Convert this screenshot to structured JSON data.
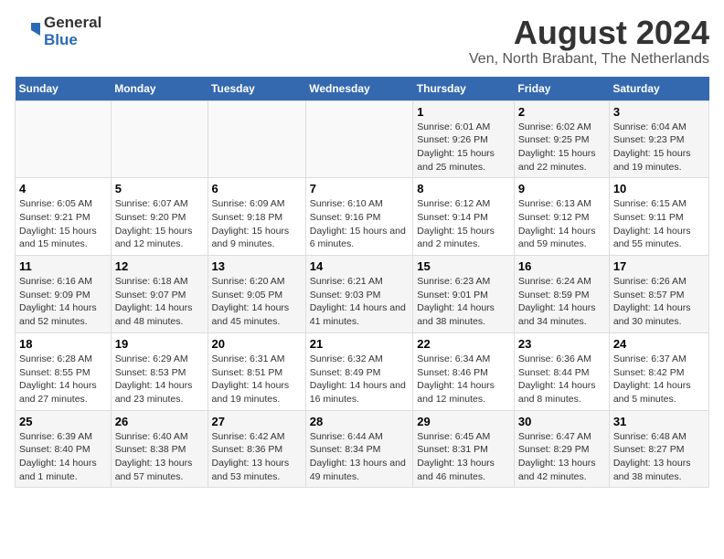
{
  "logo": {
    "general": "General",
    "blue": "Blue"
  },
  "title": "August 2024",
  "subtitle": "Ven, North Brabant, The Netherlands",
  "days_of_week": [
    "Sunday",
    "Monday",
    "Tuesday",
    "Wednesday",
    "Thursday",
    "Friday",
    "Saturday"
  ],
  "weeks": [
    [
      {
        "day": "",
        "info": ""
      },
      {
        "day": "",
        "info": ""
      },
      {
        "day": "",
        "info": ""
      },
      {
        "day": "",
        "info": ""
      },
      {
        "day": "1",
        "info": "Sunrise: 6:01 AM\nSunset: 9:26 PM\nDaylight: 15 hours and 25 minutes."
      },
      {
        "day": "2",
        "info": "Sunrise: 6:02 AM\nSunset: 9:25 PM\nDaylight: 15 hours and 22 minutes."
      },
      {
        "day": "3",
        "info": "Sunrise: 6:04 AM\nSunset: 9:23 PM\nDaylight: 15 hours and 19 minutes."
      }
    ],
    [
      {
        "day": "4",
        "info": "Sunrise: 6:05 AM\nSunset: 9:21 PM\nDaylight: 15 hours and 15 minutes."
      },
      {
        "day": "5",
        "info": "Sunrise: 6:07 AM\nSunset: 9:20 PM\nDaylight: 15 hours and 12 minutes."
      },
      {
        "day": "6",
        "info": "Sunrise: 6:09 AM\nSunset: 9:18 PM\nDaylight: 15 hours and 9 minutes."
      },
      {
        "day": "7",
        "info": "Sunrise: 6:10 AM\nSunset: 9:16 PM\nDaylight: 15 hours and 6 minutes."
      },
      {
        "day": "8",
        "info": "Sunrise: 6:12 AM\nSunset: 9:14 PM\nDaylight: 15 hours and 2 minutes."
      },
      {
        "day": "9",
        "info": "Sunrise: 6:13 AM\nSunset: 9:12 PM\nDaylight: 14 hours and 59 minutes."
      },
      {
        "day": "10",
        "info": "Sunrise: 6:15 AM\nSunset: 9:11 PM\nDaylight: 14 hours and 55 minutes."
      }
    ],
    [
      {
        "day": "11",
        "info": "Sunrise: 6:16 AM\nSunset: 9:09 PM\nDaylight: 14 hours and 52 minutes."
      },
      {
        "day": "12",
        "info": "Sunrise: 6:18 AM\nSunset: 9:07 PM\nDaylight: 14 hours and 48 minutes."
      },
      {
        "day": "13",
        "info": "Sunrise: 6:20 AM\nSunset: 9:05 PM\nDaylight: 14 hours and 45 minutes."
      },
      {
        "day": "14",
        "info": "Sunrise: 6:21 AM\nSunset: 9:03 PM\nDaylight: 14 hours and 41 minutes."
      },
      {
        "day": "15",
        "info": "Sunrise: 6:23 AM\nSunset: 9:01 PM\nDaylight: 14 hours and 38 minutes."
      },
      {
        "day": "16",
        "info": "Sunrise: 6:24 AM\nSunset: 8:59 PM\nDaylight: 14 hours and 34 minutes."
      },
      {
        "day": "17",
        "info": "Sunrise: 6:26 AM\nSunset: 8:57 PM\nDaylight: 14 hours and 30 minutes."
      }
    ],
    [
      {
        "day": "18",
        "info": "Sunrise: 6:28 AM\nSunset: 8:55 PM\nDaylight: 14 hours and 27 minutes."
      },
      {
        "day": "19",
        "info": "Sunrise: 6:29 AM\nSunset: 8:53 PM\nDaylight: 14 hours and 23 minutes."
      },
      {
        "day": "20",
        "info": "Sunrise: 6:31 AM\nSunset: 8:51 PM\nDaylight: 14 hours and 19 minutes."
      },
      {
        "day": "21",
        "info": "Sunrise: 6:32 AM\nSunset: 8:49 PM\nDaylight: 14 hours and 16 minutes."
      },
      {
        "day": "22",
        "info": "Sunrise: 6:34 AM\nSunset: 8:46 PM\nDaylight: 14 hours and 12 minutes."
      },
      {
        "day": "23",
        "info": "Sunrise: 6:36 AM\nSunset: 8:44 PM\nDaylight: 14 hours and 8 minutes."
      },
      {
        "day": "24",
        "info": "Sunrise: 6:37 AM\nSunset: 8:42 PM\nDaylight: 14 hours and 5 minutes."
      }
    ],
    [
      {
        "day": "25",
        "info": "Sunrise: 6:39 AM\nSunset: 8:40 PM\nDaylight: 14 hours and 1 minute."
      },
      {
        "day": "26",
        "info": "Sunrise: 6:40 AM\nSunset: 8:38 PM\nDaylight: 13 hours and 57 minutes."
      },
      {
        "day": "27",
        "info": "Sunrise: 6:42 AM\nSunset: 8:36 PM\nDaylight: 13 hours and 53 minutes."
      },
      {
        "day": "28",
        "info": "Sunrise: 6:44 AM\nSunset: 8:34 PM\nDaylight: 13 hours and 49 minutes."
      },
      {
        "day": "29",
        "info": "Sunrise: 6:45 AM\nSunset: 8:31 PM\nDaylight: 13 hours and 46 minutes."
      },
      {
        "day": "30",
        "info": "Sunrise: 6:47 AM\nSunset: 8:29 PM\nDaylight: 13 hours and 42 minutes."
      },
      {
        "day": "31",
        "info": "Sunrise: 6:48 AM\nSunset: 8:27 PM\nDaylight: 13 hours and 38 minutes."
      }
    ]
  ]
}
